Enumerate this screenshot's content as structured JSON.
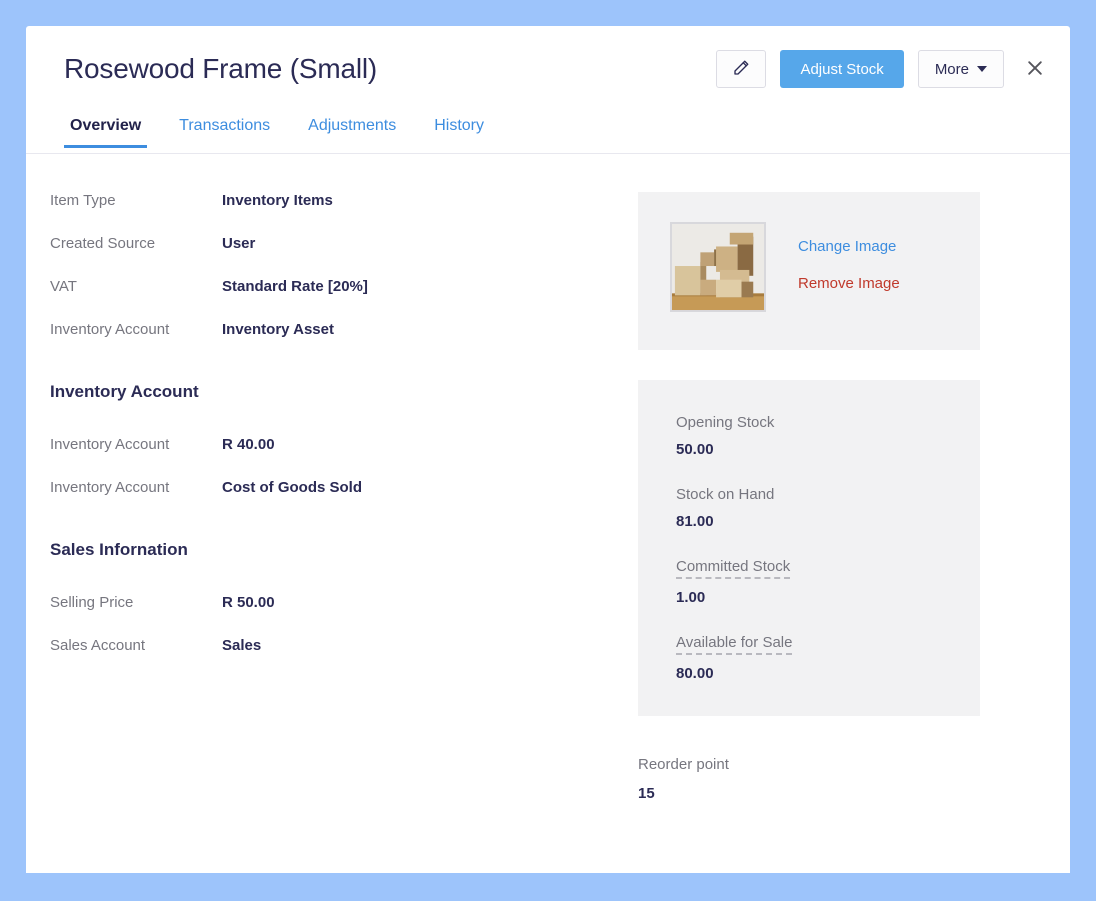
{
  "header": {
    "title": "Rosewood Frame (Small)",
    "edit_icon": "pencil-icon",
    "adjust_stock_label": "Adjust Stock",
    "more_label": "More",
    "close_icon": "close-icon"
  },
  "tabs": [
    {
      "label": "Overview",
      "active": true
    },
    {
      "label": "Transactions",
      "active": false
    },
    {
      "label": "Adjustments",
      "active": false
    },
    {
      "label": "History",
      "active": false
    }
  ],
  "details": [
    {
      "label": "Item Type",
      "value": "Inventory Items"
    },
    {
      "label": "Created Source",
      "value": "User"
    },
    {
      "label": "VAT",
      "value": "Standard Rate [20%]"
    },
    {
      "label": "Inventory Account",
      "value": "Inventory Asset"
    }
  ],
  "inventory_section": {
    "title": "Inventory Account",
    "rows": [
      {
        "label": "Inventory Account",
        "value": "R 40.00"
      },
      {
        "label": "Inventory Account",
        "value": "Cost of Goods Sold"
      }
    ]
  },
  "sales_section": {
    "title": "Sales Infornation",
    "rows": [
      {
        "label": "Selling Price",
        "value": "R 50.00"
      },
      {
        "label": "Sales Account",
        "value": "Sales"
      }
    ]
  },
  "image_panel": {
    "thumbnail_alt": "stacked cardboard boxes product photo",
    "change_label": "Change Image",
    "remove_label": "Remove Image"
  },
  "stock_panel": [
    {
      "label": "Opening Stock",
      "value": "50.00",
      "dashed": false
    },
    {
      "label": "Stock on Hand",
      "value": "81.00",
      "dashed": false
    },
    {
      "label": "Committed Stock",
      "value": "1.00",
      "dashed": true
    },
    {
      "label": "Available for Sale",
      "value": "80.00",
      "dashed": true
    }
  ],
  "reorder": {
    "label": "Reorder point",
    "value": "15"
  },
  "colors": {
    "page_background": "#9dc4fb",
    "card_background": "#ffffff",
    "accent_blue": "#3d8ddf",
    "primary_button": "#56a7ea",
    "text_dark": "#2b2b55",
    "text_muted": "#76767f",
    "panel_gray": "#f2f2f3",
    "danger_red": "#c0392b"
  }
}
